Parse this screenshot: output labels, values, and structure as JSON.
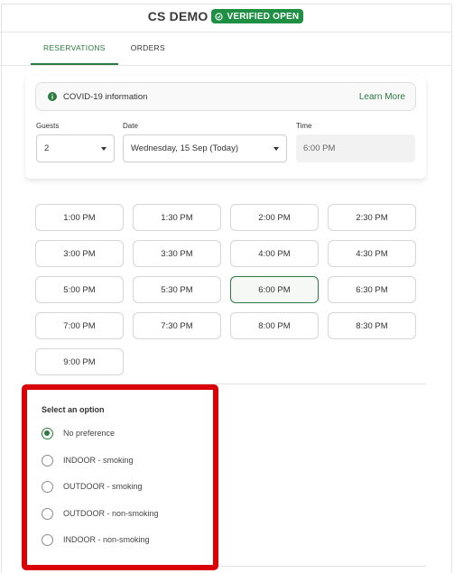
{
  "header": {
    "brand": "CS DEMO",
    "badge": "VERIFIED OPEN",
    "badge_icon": "check-circle-icon",
    "badge_color": "#1e8f43"
  },
  "tabs": [
    {
      "label": "RESERVATIONS",
      "active": true
    },
    {
      "label": "ORDERS",
      "active": false
    }
  ],
  "covid": {
    "icon": "info-icon",
    "text": "COVID-19 information",
    "link": "Learn More"
  },
  "form": {
    "guests": {
      "label": "Guests",
      "value": "2"
    },
    "date": {
      "label": "Date",
      "value": "Wednesday, 15 Sep (Today)"
    },
    "time": {
      "label": "Time",
      "value": "6:00 PM"
    }
  },
  "time_slots": [
    {
      "label": "1:00 PM",
      "selected": false
    },
    {
      "label": "1:30 PM",
      "selected": false
    },
    {
      "label": "2:00 PM",
      "selected": false
    },
    {
      "label": "2:30 PM",
      "selected": false
    },
    {
      "label": "3:00 PM",
      "selected": false
    },
    {
      "label": "3:30 PM",
      "selected": false
    },
    {
      "label": "4:00 PM",
      "selected": false
    },
    {
      "label": "4:30 PM",
      "selected": false
    },
    {
      "label": "5:00 PM",
      "selected": false
    },
    {
      "label": "5:30 PM",
      "selected": false
    },
    {
      "label": "6:00 PM",
      "selected": true
    },
    {
      "label": "6:30 PM",
      "selected": false
    },
    {
      "label": "7:00 PM",
      "selected": false
    },
    {
      "label": "7:30 PM",
      "selected": false
    },
    {
      "label": "8:00 PM",
      "selected": false
    },
    {
      "label": "8:30 PM",
      "selected": false
    },
    {
      "label": "9:00 PM",
      "selected": false
    }
  ],
  "seating": {
    "title": "Select an option",
    "highlight_color": "#d90007",
    "options": [
      {
        "label": "No preference",
        "checked": true
      },
      {
        "label": "INDOOR - smoking",
        "checked": false
      },
      {
        "label": "OUTDOOR - smoking",
        "checked": false
      },
      {
        "label": "OUTDOOR - non-smoking",
        "checked": false
      },
      {
        "label": "INDOOR - non-smoking",
        "checked": false
      }
    ]
  },
  "colors": {
    "accent_green": "#2b7a3f"
  }
}
